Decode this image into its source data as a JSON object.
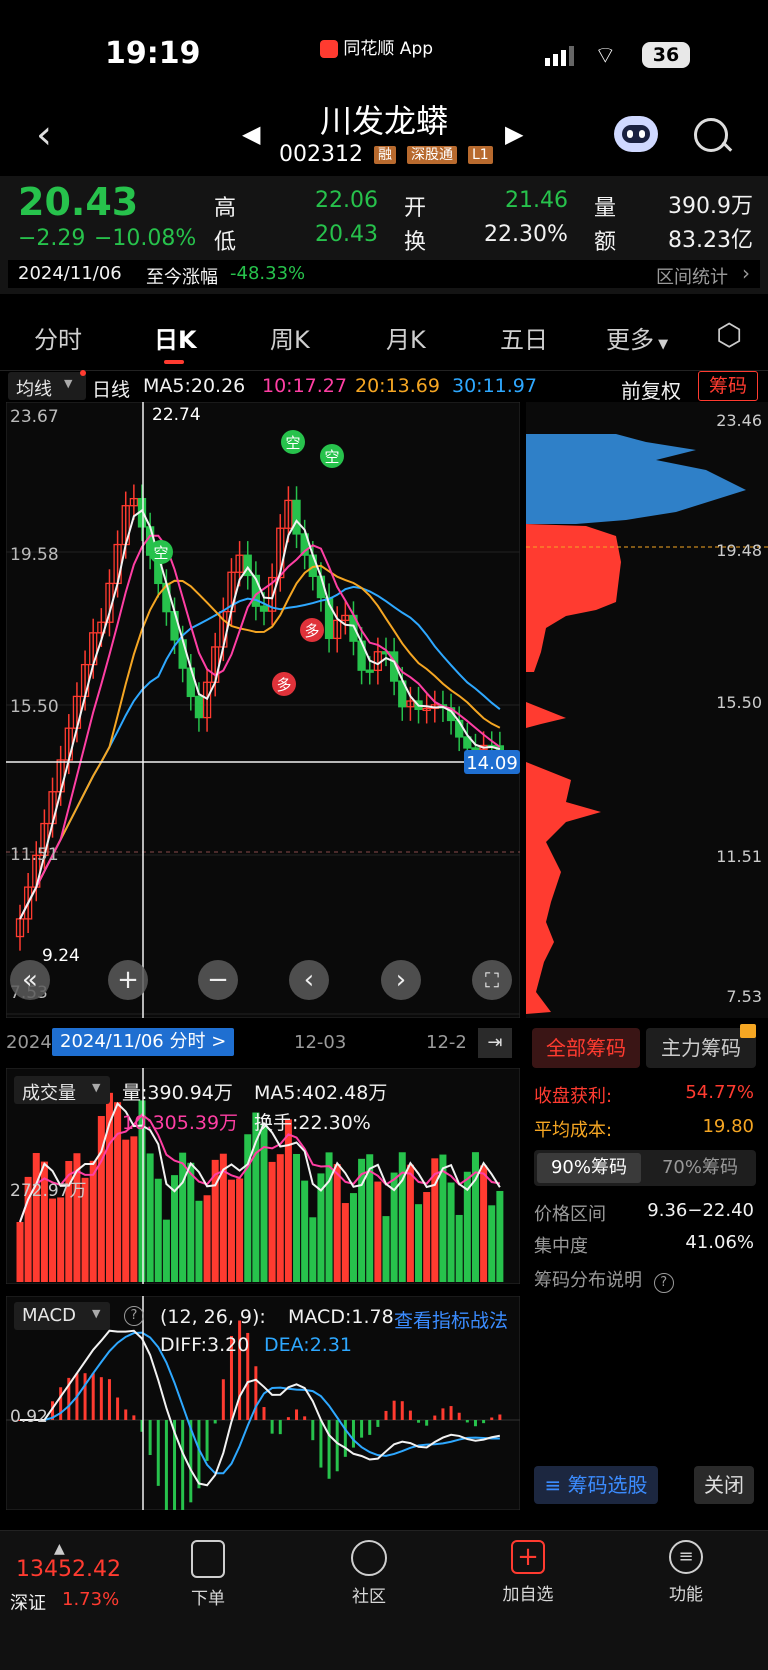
{
  "status_bar": {
    "time": "19:19",
    "app_tag": "同花顺 App",
    "battery": "36"
  },
  "header": {
    "title": "川发龙蟒",
    "code": "002312",
    "badges": [
      "融",
      "深股通",
      "L1"
    ]
  },
  "quote": {
    "price": "20.43",
    "change": "−2.29",
    "change_pct": "−10.08%",
    "high_label": "高",
    "high": "22.06",
    "low_label": "低",
    "low": "20.43",
    "open_label": "开",
    "open": "21.46",
    "turnover_label": "换",
    "turnover": "22.30%",
    "volume_label": "量",
    "volume": "390.9万",
    "amount_label": "额",
    "amount": "83.23亿",
    "date": "2024/11/06",
    "since_label": "至今涨幅",
    "since_value": "-48.33%",
    "range_stat": "区间统计"
  },
  "tabs": [
    "分时",
    "日K",
    "周K",
    "月K",
    "五日",
    "更多"
  ],
  "active_tab": "日K",
  "ma_bar": {
    "selector": "均线",
    "period": "日线",
    "ma5": "MA5:20.26",
    "ma10": "10:17.27",
    "ma20": "20:13.69",
    "ma30": "30:11.97",
    "adjust": "前复权",
    "chips_button": "筹码"
  },
  "kline": {
    "price_labels": [
      "23.67",
      "19.58",
      "15.50",
      "11.51",
      "7.53"
    ],
    "max_label": "22.74",
    "min_label": "9.24",
    "current_price_tag": "14.09",
    "left_label_1151": "11.51",
    "signals": [
      "空",
      "空",
      "空",
      "多",
      "多"
    ],
    "date_left": "2024",
    "date_tag": "2024/11/06 分时 >",
    "date_mid": "12-03",
    "date_right": "12-2"
  },
  "chip_panel": {
    "prices": [
      "23.46",
      "19.48",
      "15.50",
      "11.51",
      "7.53"
    ],
    "tab_all": "全部筹码",
    "tab_main": "主力筹码",
    "profit_label": "收盘获利:",
    "profit_value": "54.77%",
    "cost_label": "平均成本:",
    "cost_value": "19.80",
    "chips90": "90%筹码",
    "chips70": "70%筹码",
    "range_label": "价格区间",
    "range_value": "9.36−22.40",
    "conc_label": "集中度",
    "conc_value": "41.06%",
    "desc_label": "筹码分布说明",
    "select_button": "筹码选股",
    "close_button": "关闭"
  },
  "volume": {
    "selector": "成交量",
    "vol": "量:390.94万",
    "ma5": "MA5:402.48万",
    "ma10": "10:305.39万",
    "turnover": "换手:22.30%",
    "axis_label": "272.97万"
  },
  "macd": {
    "selector": "MACD",
    "params": "(12, 26, 9):",
    "macd": "MACD:1.78",
    "strategy": "查看指标战法",
    "diff": "DIFF:3.20",
    "dea": "DEA:2.31",
    "axis_label": "0.92"
  },
  "bottom_nav": {
    "index_value": "13452.42",
    "index_name": "深证",
    "index_change": "1.73%",
    "items": [
      "下单",
      "社区",
      "加自选",
      "功能"
    ]
  },
  "colors": {
    "up": "#ff3b30",
    "down": "#27c24c",
    "ma5": "#f2f2f2",
    "ma10": "#ff3fa4",
    "ma20": "#f5a623",
    "ma30": "#2ea8ff",
    "accent": "#ff3b30"
  }
}
